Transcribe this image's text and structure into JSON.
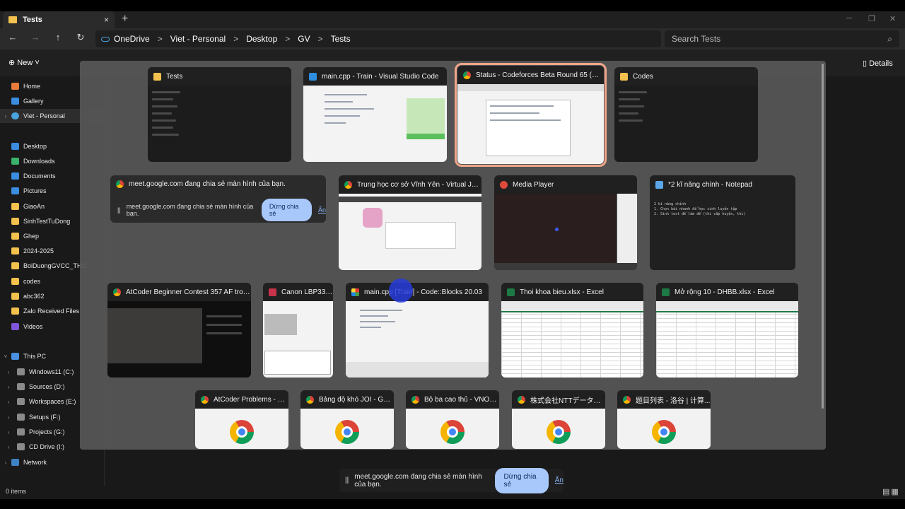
{
  "tab": {
    "title": "Tests",
    "close": "×",
    "new": "+"
  },
  "window_controls": [
    "─",
    "❐",
    "✕"
  ],
  "nav": {
    "back": "←",
    "forward": "→",
    "up": "↑",
    "refresh": "↻"
  },
  "breadcrumb": [
    "OneDrive",
    "Viet - Personal",
    "Desktop",
    "GV",
    "Tests"
  ],
  "breadcrumb_sep": ">",
  "search": {
    "placeholder": "Search Tests",
    "icon": "⌕"
  },
  "command_bar": {
    "new_label": "New",
    "details_label": "Details"
  },
  "sidebar": [
    {
      "label": "Home",
      "icon": "home"
    },
    {
      "label": "Gallery",
      "icon": "gallery"
    },
    {
      "label": "Viet - Personal",
      "icon": "cloud",
      "selected": true
    },
    {
      "label": "Desktop",
      "icon": "desktop"
    },
    {
      "label": "Downloads",
      "icon": "downloads"
    },
    {
      "label": "Documents",
      "icon": "documents"
    },
    {
      "label": "Pictures",
      "icon": "pictures"
    },
    {
      "label": "GiaoAn",
      "icon": "folder"
    },
    {
      "label": "SinhTestTuDong",
      "icon": "folder"
    },
    {
      "label": "Ghep",
      "icon": "folder"
    },
    {
      "label": "2024-2025",
      "icon": "folder"
    },
    {
      "label": "BoiDuongGVCC_THC",
      "icon": "folder"
    },
    {
      "label": "codes",
      "icon": "folder"
    },
    {
      "label": "abc362",
      "icon": "folder"
    },
    {
      "label": "Zalo Received Files",
      "icon": "folder"
    },
    {
      "label": "Videos",
      "icon": "videos"
    },
    {
      "label": "This PC",
      "icon": "pc"
    },
    {
      "label": "Windows11 (C:)",
      "icon": "drive"
    },
    {
      "label": "Sources (D:)",
      "icon": "drive"
    },
    {
      "label": "Workspaces (E:)",
      "icon": "drive"
    },
    {
      "label": "Setups (F:)",
      "icon": "drive"
    },
    {
      "label": "Projects (G:)",
      "icon": "drive"
    },
    {
      "label": "CD Drive (I:)",
      "icon": "drive"
    },
    {
      "label": "Network",
      "icon": "network"
    }
  ],
  "status": {
    "items": "0 items"
  },
  "windows": [
    {
      "title": "Tests",
      "icon": "folder"
    },
    {
      "title": "main.cpp - Train - Visual Studio Code",
      "icon": "vscode"
    },
    {
      "title": "Status - Codeforces Beta Round 65 (Div...",
      "icon": "chrome",
      "focused": true
    },
    {
      "title": "Codes",
      "icon": "folder"
    },
    {
      "title": "Trung học cơ sở Vĩnh Yên - Virtual Judg...",
      "icon": "chrome"
    },
    {
      "title": "Media Player",
      "icon": "media"
    },
    {
      "title": "*2 kĩ năng chính - Notepad",
      "icon": "notepad"
    },
    {
      "title": "AtCoder Beginner Contest 357 AF trong...",
      "icon": "chrome"
    },
    {
      "title": "Canon LBP3300",
      "icon": "canon"
    },
    {
      "title": "main.cpp [Train] - Code::Blocks 20.03",
      "icon": "codeblocks"
    },
    {
      "title": "Thoi khoa bieu.xlsx - Excel",
      "icon": "excel"
    },
    {
      "title": "Mở rộng 10 - DHBB.xlsx - Excel",
      "icon": "excel"
    },
    {
      "title": "AtCoder Problems - G...",
      "icon": "chrome"
    },
    {
      "title": "Bảng độ khó JOI - Goo...",
      "icon": "chrome"
    },
    {
      "title": "Bộ ba cao thủ - VNOJ:...",
      "icon": "chrome"
    },
    {
      "title": "株式会社NTTデータ数理...",
      "icon": "chrome"
    },
    {
      "title": "题目列表 - 洛谷 | 计算...",
      "icon": "chrome"
    }
  ],
  "share_card": {
    "title": "meet.google.com đang chia sẻ màn hình của bạn.",
    "message": "meet.google.com đang chia sẻ màn hình của bạn.",
    "stop_label": "Dừng chia sẻ",
    "hide_label": "Ẩn"
  },
  "share_bar": {
    "message": "meet.google.com đang chia sẻ màn hình của bạn.",
    "stop_label": "Dừng chia sẻ",
    "hide_label": "Ẩn"
  },
  "notepad_preview": [
    "2 kĩ năng chính",
    "1. Chọn bài nhanh để học sinh luyện tập",
    "2. Sinh test để làm đề (thi cấp huyện, thi)"
  ]
}
